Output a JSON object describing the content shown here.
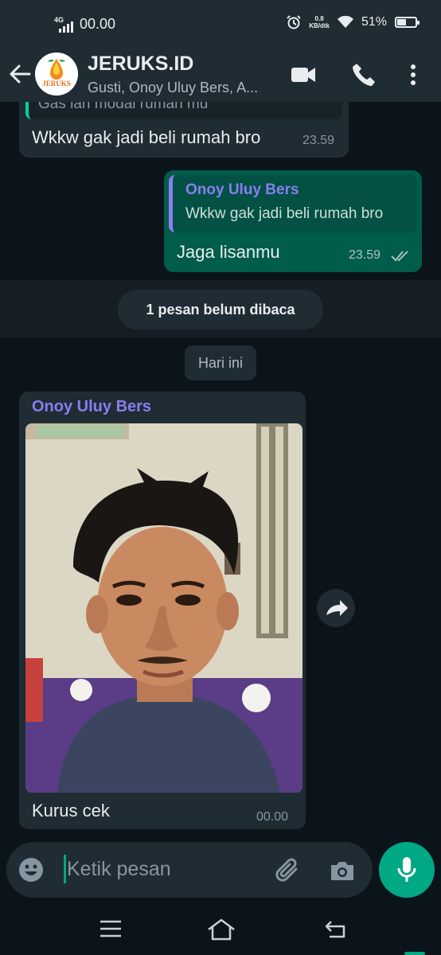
{
  "status_bar": {
    "network": "4G",
    "time": "00.00",
    "speed_top": "0.8",
    "speed_bottom": "KB/dtk",
    "battery": "51%",
    "battery_level": 0.51
  },
  "header": {
    "title": "JERUKS.ID",
    "subtitle": "Gusti, Onoy Uluy Bers, A...",
    "avatar_logo_text": "JERUKS"
  },
  "messages": [
    {
      "type": "incoming",
      "text_partial_top": "Gas lah modal rumah mu",
      "text": "Wkkw gak jadi beli rumah bro",
      "time": "23.59"
    },
    {
      "type": "outgoing",
      "quote_name": "Onoy Uluy Bers",
      "quote_text": "Wkkw gak jadi beli rumah bro",
      "text": "Jaga lisanmu",
      "time": "23.59"
    },
    {
      "type": "system",
      "text": "1 pesan belum dibaca"
    },
    {
      "type": "date",
      "text": "Hari ini"
    },
    {
      "type": "incoming_image",
      "sender": "Onoy Uluy Bers",
      "caption": "Kurus cek",
      "time": "00.00"
    }
  ],
  "input": {
    "placeholder": "Ketik pesan"
  },
  "colors": {
    "background": "#0b141a",
    "bar": "#1f2c34",
    "outgoing": "#005c4b",
    "accent": "#00a884",
    "sender_name": "#8a7df0"
  }
}
